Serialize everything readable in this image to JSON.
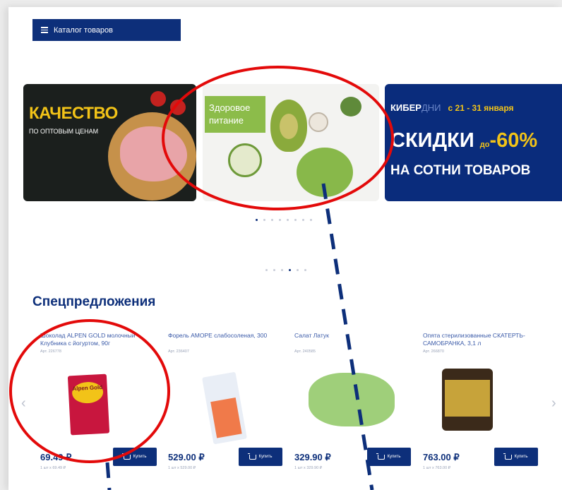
{
  "header": {
    "catalog_label": "Каталог товаров"
  },
  "banners": [
    {
      "title": "КАЧЕСТВО",
      "subtitle": "ПО ОПТОВЫМ ЦЕНАМ"
    },
    {
      "tag_line1": "Здоровое",
      "tag_line2": "питание"
    },
    {
      "line1_a": "КИБЕР",
      "line1_b": "ДНИ",
      "date": "с 21 - 31 января",
      "line2_a": "СКИДКИ",
      "line2_b": "до",
      "line2_c": "-60%",
      "line3": "НА СОТНИ ТОВАРОВ"
    }
  ],
  "banner_dots": {
    "count": 8,
    "active": 0
  },
  "promo_dots": {
    "count": 6,
    "active": 3
  },
  "section": {
    "title": "Спецпредложения"
  },
  "products": [
    {
      "name": "Шоколад ALPEN GOLD молочный Клубника с йогуртом, 90г",
      "art": "Арт. 226778",
      "price": "69.49 ₽",
      "unit": "1 шт х 69.49 ₽",
      "buy": "Купить",
      "brand": "Alpen Gold"
    },
    {
      "name": "Форель АМОРЕ слабосоленая, 300",
      "art": "Арт. 236407",
      "price": "529.00 ₽",
      "unit": "1 шт х 529.00 ₽",
      "buy": "Купить"
    },
    {
      "name": "Салат Латук",
      "art": "Арт. 240585",
      "price": "329.90 ₽",
      "unit": "1 шт х 329.90 ₽",
      "buy": "Купить"
    },
    {
      "name": "Опята стерилизованные СКАТЕРТЬ-САМОБРАНКА, 3,1 л",
      "art": "Арт. 266870",
      "price": "763.00 ₽",
      "unit": "1 шт х 763.00 ₽",
      "buy": "Купить"
    }
  ],
  "carousel": {
    "prev_icon": "‹",
    "next_icon": "›"
  },
  "annotation_colors": {
    "ellipse": "#e30a0a",
    "dashed_line": "#0d2f7a"
  }
}
